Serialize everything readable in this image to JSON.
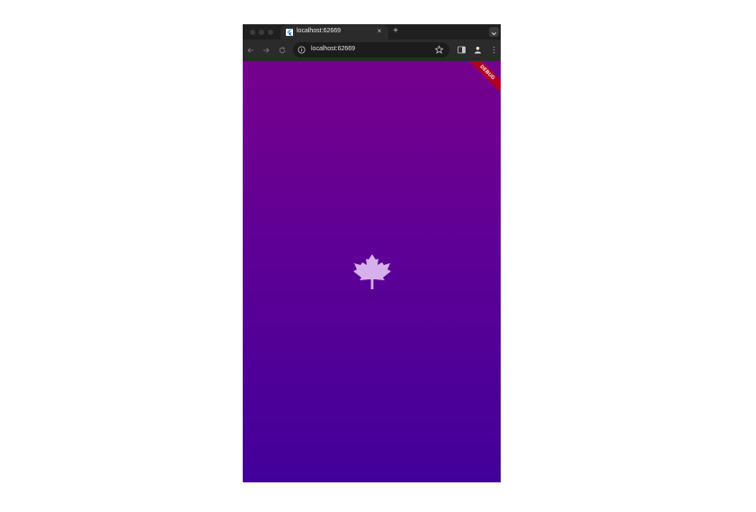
{
  "browser": {
    "tab": {
      "title": "localhost:62669",
      "close_glyph": "×"
    },
    "new_tab_glyph": "+",
    "omnibox": {
      "url": "localhost:62669"
    },
    "icons": {
      "back": "arrow-left-icon",
      "forward": "arrow-right-icon",
      "reload": "reload-icon",
      "site_info": "info-circle-icon",
      "bookmark": "star-icon",
      "side_panel": "side-panel-icon",
      "profile": "person-icon",
      "menu": "more-vert-icon",
      "tab_search": "chevron-down-icon"
    }
  },
  "app": {
    "gradient_top": "#76008e",
    "gradient_bottom": "#42009a",
    "center_icon": "maple-leaf-icon",
    "icon_color": "#d6b0ea",
    "debug_banner": "DEBUG",
    "debug_color": "#b00020"
  }
}
